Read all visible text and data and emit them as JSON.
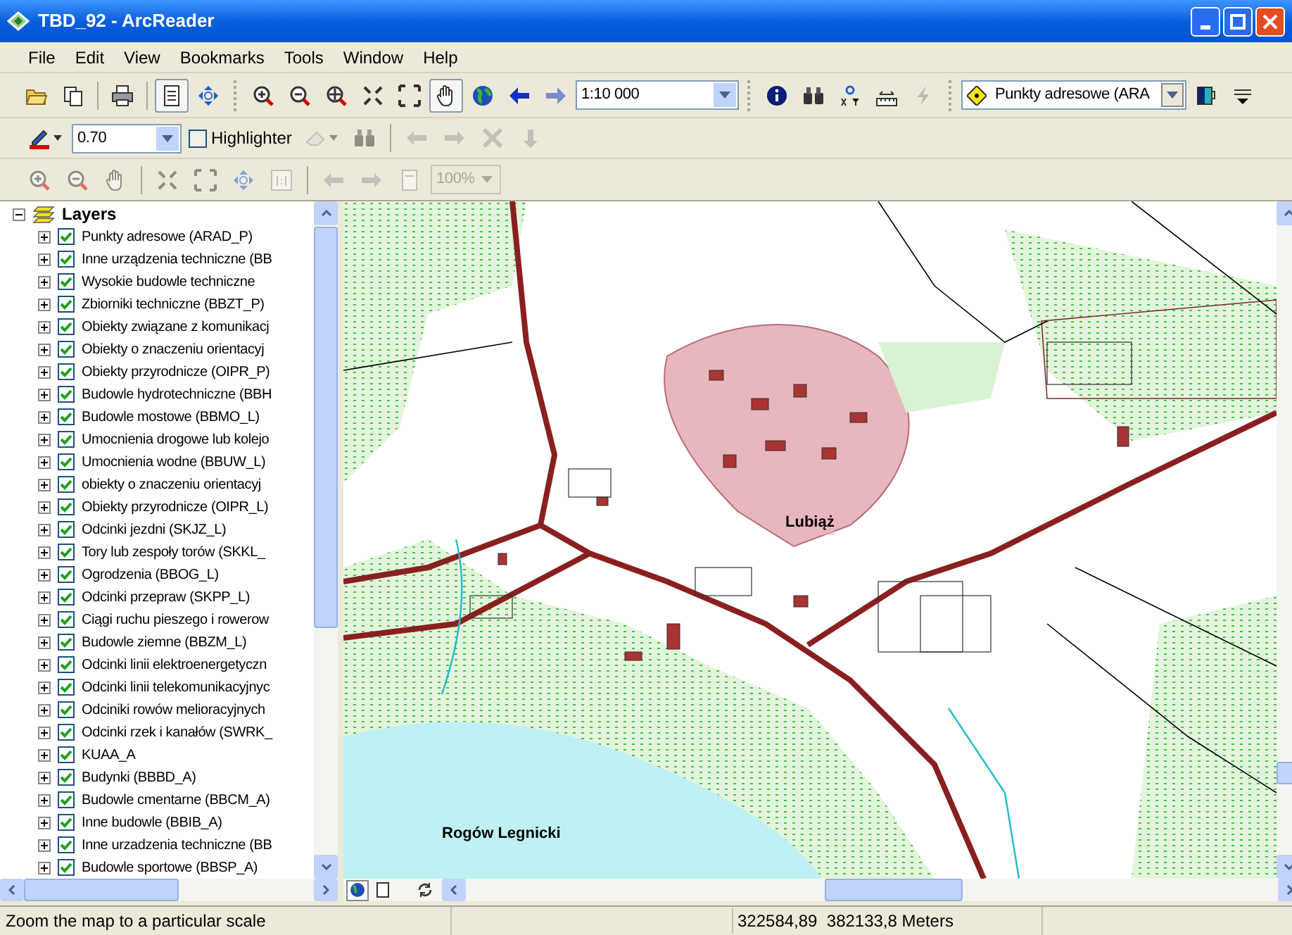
{
  "window": {
    "title": "TBD_92 - ArcReader"
  },
  "menu": [
    "File",
    "Edit",
    "View",
    "Bookmarks",
    "Tools",
    "Window",
    "Help"
  ],
  "toolbar_main": [
    {
      "kind": "open"
    },
    {
      "kind": "copy"
    },
    {
      "kind": "sep"
    },
    {
      "kind": "print"
    },
    {
      "kind": "sep"
    },
    {
      "kind": "layout",
      "selected": true
    },
    {
      "kind": "fullextent",
      "selected": false
    },
    {
      "kind": "grip"
    },
    {
      "kind": "zoomin",
      "selected": false
    },
    {
      "kind": "zoomout",
      "selected": false
    },
    {
      "kind": "zoomfull",
      "selected": false
    },
    {
      "kind": "fixedin",
      "selected": false
    },
    {
      "kind": "fixedout",
      "selected": false
    },
    {
      "kind": "pan",
      "selected": true
    },
    {
      "kind": "globe"
    },
    {
      "kind": "back",
      "disabled": false
    },
    {
      "kind": "forward",
      "disabled": true
    },
    {
      "kind": "scale",
      "value": "1:10 000"
    },
    {
      "kind": "grip"
    },
    {
      "kind": "identify",
      "selected": false
    },
    {
      "kind": "find"
    },
    {
      "kind": "gotoxy"
    },
    {
      "kind": "measure",
      "selected": false
    },
    {
      "kind": "flash",
      "disabled": true
    },
    {
      "kind": "grip"
    },
    {
      "kind": "layercombo",
      "value": "Punkty adresowe (ARA"
    },
    {
      "kind": "swipe"
    },
    {
      "kind": "more"
    }
  ],
  "toolbar_draw": [
    {
      "kind": "pen"
    },
    {
      "kind": "linewidth",
      "value": "0.70"
    },
    {
      "kind": "check",
      "label": "Highlighter",
      "checked": false
    },
    {
      "kind": "eraser",
      "disabled": true
    },
    {
      "kind": "find",
      "disabled": true
    },
    {
      "kind": "sep"
    },
    {
      "kind": "arrowl",
      "disabled": true
    },
    {
      "kind": "arrowr",
      "disabled": true
    },
    {
      "kind": "cross",
      "disabled": true
    },
    {
      "kind": "down",
      "disabled": true
    }
  ],
  "toolbar_view": [
    {
      "kind": "zoomin",
      "disabled": true
    },
    {
      "kind": "zoomout",
      "disabled": true
    },
    {
      "kind": "pan",
      "disabled": true
    },
    {
      "kind": "sep"
    },
    {
      "kind": "fixedin",
      "disabled": true
    },
    {
      "kind": "fixedout",
      "disabled": true
    },
    {
      "kind": "fullextent",
      "disabled": true
    },
    {
      "kind": "onetoone",
      "disabled": true
    },
    {
      "kind": "sep"
    },
    {
      "kind": "arrowl",
      "disabled": true
    },
    {
      "kind": "arrowr",
      "disabled": true
    },
    {
      "kind": "page",
      "disabled": true
    },
    {
      "kind": "percent",
      "value": "100%",
      "disabled": true
    }
  ],
  "toc": {
    "title": "Layers",
    "expanded": true,
    "layers": [
      {
        "name": "Punkty adresowe (ARAD_P)",
        "checked": true,
        "expanded": false
      },
      {
        "name": "Inne urządzenia techniczne (BB",
        "checked": true,
        "expanded": false
      },
      {
        "name": "Wysokie budowle techniczne",
        "checked": true,
        "expanded": false
      },
      {
        "name": "Zbiorniki techniczne (BBZT_P)",
        "checked": true,
        "expanded": false
      },
      {
        "name": "Obiekty związane z komunikacj",
        "checked": true,
        "expanded": false
      },
      {
        "name": "Obiekty o znaczeniu orientacyj",
        "checked": true,
        "expanded": false
      },
      {
        "name": "Obiekty przyrodnicze (OIPR_P)",
        "checked": true,
        "expanded": false
      },
      {
        "name": "Budowle hydrotechniczne (BBH",
        "checked": true,
        "expanded": false
      },
      {
        "name": "Budowle mostowe (BBMO_L)",
        "checked": true,
        "expanded": false
      },
      {
        "name": "Umocnienia drogowe lub kolejo",
        "checked": true,
        "expanded": false
      },
      {
        "name": "Umocnienia wodne (BBUW_L)",
        "checked": true,
        "expanded": false
      },
      {
        "name": "obiekty o znaczeniu orientacyj",
        "checked": true,
        "expanded": false
      },
      {
        "name": "Obiekty przyrodnicze (OIPR_L)",
        "checked": true,
        "expanded": false
      },
      {
        "name": "Odcinki jezdni (SKJZ_L)",
        "checked": true,
        "expanded": false
      },
      {
        "name": "Tory lub zespoły torów (SKKL_",
        "checked": true,
        "expanded": false
      },
      {
        "name": "Ogrodzenia (BBOG_L)",
        "checked": true,
        "expanded": false
      },
      {
        "name": "Odcinki przepraw (SKPP_L)",
        "checked": true,
        "expanded": false
      },
      {
        "name": "Ciągi ruchu pieszego i rowerow",
        "checked": true,
        "expanded": false
      },
      {
        "name": "Budowle ziemne (BBZM_L)",
        "checked": true,
        "expanded": false
      },
      {
        "name": "Odcinki linii elektroenergetyczn",
        "checked": true,
        "expanded": false
      },
      {
        "name": "Odcinki linii telekomunikacyjnyc",
        "checked": true,
        "expanded": false
      },
      {
        "name": "Odciniki rowów melioracyjnych",
        "checked": true,
        "expanded": false
      },
      {
        "name": "Odcinki rzek i kanałów (SWRK_",
        "checked": true,
        "expanded": false
      },
      {
        "name": "KUAA_A",
        "checked": true,
        "expanded": false
      },
      {
        "name": "Budynki (BBBD_A)",
        "checked": true,
        "expanded": false
      },
      {
        "name": "Budowle cmentarne (BBCM_A)",
        "checked": true,
        "expanded": false
      },
      {
        "name": "Inne budowle (BBIB_A)",
        "checked": true,
        "expanded": false
      },
      {
        "name": "Inne urzadzenia techniczne (BB",
        "checked": true,
        "expanded": false
      },
      {
        "name": "Budowle sportowe (BBSP_A)",
        "checked": true,
        "expanded": false
      }
    ]
  },
  "map": {
    "labels": [
      {
        "text": "Lubiąż",
        "kind": "town"
      },
      {
        "text": "Rogów Legnicki",
        "kind": "village"
      }
    ]
  },
  "view_tabs": [
    {
      "kind": "data",
      "selected": true
    },
    {
      "kind": "layout",
      "selected": false
    }
  ],
  "status_bar": {
    "message": "Zoom the map to a particular scale",
    "coordinates": "322584,89  382133,8 Meters"
  }
}
